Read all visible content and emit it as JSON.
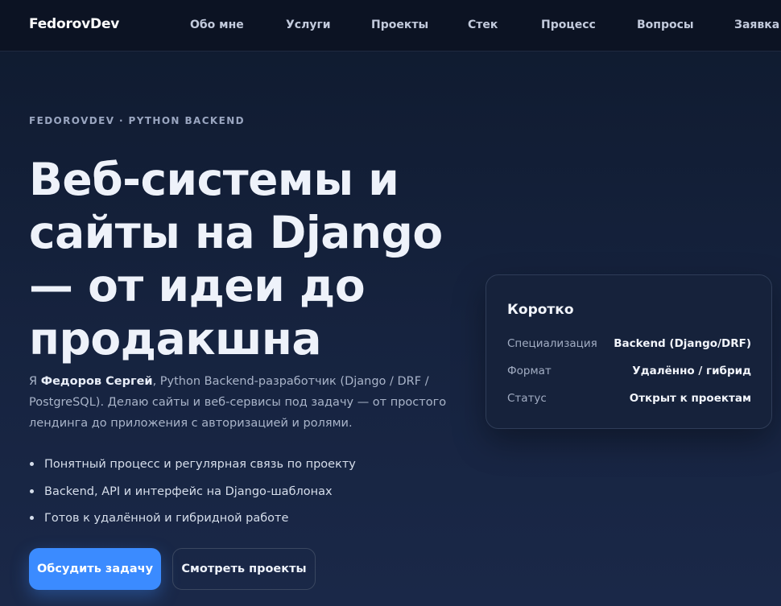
{
  "nav": {
    "brand": "FedorovDev",
    "links": [
      "Обо мне",
      "Услуги",
      "Проекты",
      "Стек",
      "Процесс",
      "Вопросы",
      "Заявка"
    ]
  },
  "hero": {
    "eyebrow": "FEDOROVDEV · PYTHON BACKEND",
    "headline": "Веб-системы и сайты на Django — от идеи до продакшна",
    "intro_prefix": "Я ",
    "intro_name": "Федоров Сергей",
    "intro_rest": ", Python Backend-разработчик (Django / DRF / PostgreSQL). Делаю сайты и веб-сервисы под задачу — от простого лендинга до приложения с авторизацией и ролями.",
    "bullets": [
      "Понятный процесс и регулярная связь по проекту",
      "Backend, API и интерфейс на Django-шаблонах",
      "Готов к удалённой и гибридной работе"
    ],
    "primary_button": "Обсудить задачу",
    "secondary_button": "Смотреть проекты"
  },
  "summary": {
    "title": "Коротко",
    "rows": [
      {
        "label": "Специализация",
        "value": "Backend (Django/DRF)"
      },
      {
        "label": "Формат",
        "value": "Удалённо / гибрид"
      },
      {
        "label": "Статус",
        "value": "Открыт к проектам"
      }
    ]
  },
  "colors": {
    "accent": "#3b8bff",
    "background": "#0f1a2e",
    "navbar": "#0c1323",
    "card": "#16223b"
  }
}
